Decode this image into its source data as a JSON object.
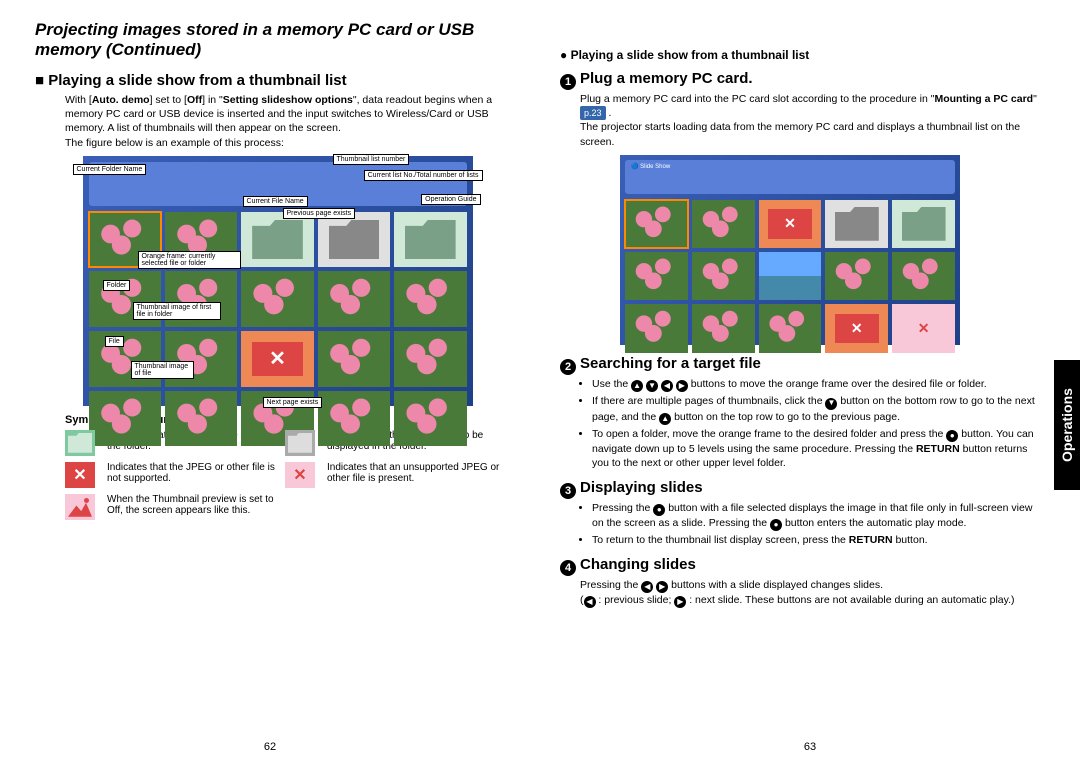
{
  "title": "Projecting images stored in a memory PC card or USB memory (Continued)",
  "left": {
    "heading": "Playing a slide show from a thumbnail list",
    "intro": "With [<b>Auto. demo</b>] set to [<b>Off</b>] in \"<b>Setting slideshow options</b>\", data readout begins when a memory PC card or USB device is inserted and the input switches to Wireless/Card or USB memory. A list of thumbnails will then appear on the screen.<br>The figure below is an example of this process:",
    "callouts": {
      "cfn": "Current Folder Name",
      "tln": "Thumbnail list number",
      "cln": "Current list No./Total number of lists",
      "cfi": "Current File Name",
      "og": "Operation Guide",
      "ppe": "Previous page exists",
      "orange": "Orange frame: currently selected file or folder",
      "folder": "Folder",
      "tiff": "Thumbnail image of first file in folder",
      "file": "File",
      "tif": "Thumbnail image of file",
      "npe": "Next page exists"
    },
    "symbolsTitle": "Symbols in the thumbnail list",
    "symbols": [
      "Indicates that only folders are inside the folder.",
      "Indicates that there is no data to be displayed in the folder.",
      "Indicates that the JPEG or other file is not supported.",
      "Indicates that an unsupported JPEG or other file is present.",
      "When the Thumbnail preview is set to Off, the screen appears like this."
    ]
  },
  "right": {
    "subhead": "Playing a slide show from a thumbnail list",
    "steps": [
      {
        "num": "1",
        "title": "Plug a memory PC card.",
        "body": "Plug a memory PC card into the PC card slot according to the procedure in \"<b>Mounting a PC card</b>\" <span class='pref'>p.23</span> .<br>The projector starts loading data from the memory PC card and displays a thumbnail list on the screen."
      },
      {
        "num": "2",
        "title": "Searching for a target file",
        "bullets": [
          "Use the <span class='arrow-btn'>▲</span> <span class='arrow-btn'>▼</span> <span class='arrow-btn'>◀</span> <span class='arrow-btn'>▶</span> buttons to move the orange frame over the desired file or folder.",
          "If there are multiple pages of thumbnails, click the <span class='arrow-btn'>▼</span> button on the bottom row to go to the next page, and the <span class='arrow-btn'>▲</span> button on the top row to go to the previous page.",
          "To open a folder, move the orange frame to the desired folder and press the <span class='arrow-btn'>●</span> button. You can navigate down up to 5 levels using the same procedure. Pressing the <b>RETURN</b> button returns you to the next or other upper level folder."
        ]
      },
      {
        "num": "3",
        "title": "Displaying slides",
        "bullets": [
          "Pressing the <span class='arrow-btn'>●</span> button with a file selected displays the image in that file only in full-screen view on the screen as a slide. Pressing the <span class='arrow-btn'>●</span> button enters the automatic play mode.",
          "To return to the thumbnail list display screen, press the <b>RETURN</b> button."
        ]
      },
      {
        "num": "4",
        "title": "Changing slides",
        "body": "Pressing the <span class='arrow-btn'>◀</span> <span class='arrow-btn'>▶</span> buttons with a slide displayed changes slides.<br>(<span class='arrow-btn'>◀</span> : previous slide; <span class='arrow-btn'>▶</span> : next slide. These buttons are not available during an automatic play.)"
      }
    ]
  },
  "sideTab": "Operations",
  "pageLeft": "62",
  "pageRight": "63"
}
